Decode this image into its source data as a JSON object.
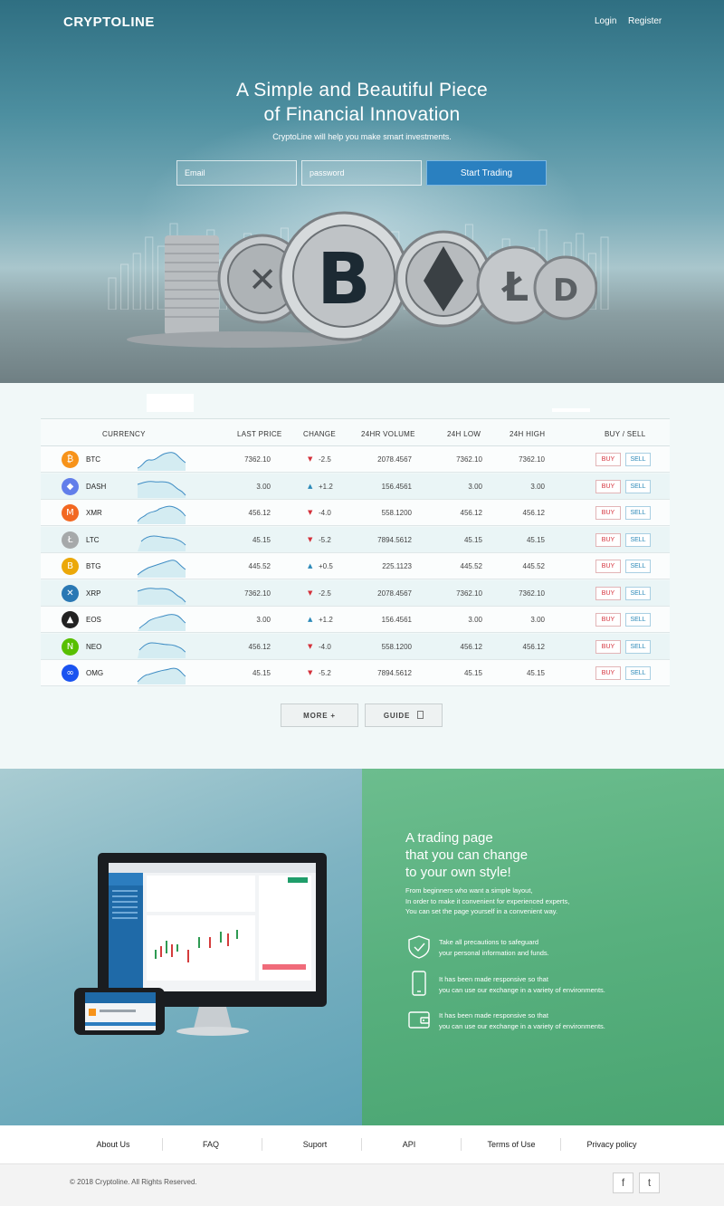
{
  "header": {
    "brand": "CRYPTOLINE",
    "login": "Login",
    "register": "Register"
  },
  "hero": {
    "title_line1": "A Simple and Beautiful Piece",
    "title_line2": "of Financial Innovation",
    "subtitle": "CryptoLine will help you make smart investments.",
    "email_placeholder": "Email",
    "password_placeholder": "password",
    "start_label": "Start Trading"
  },
  "market": {
    "headers": {
      "currency": "CURRENCY",
      "last_price": "LAST PRICE",
      "change": "CHANGE",
      "volume": "24HR VOLUME",
      "low": "24H LOW",
      "high": "24H HIGH",
      "buysell": "BUY / SELL"
    },
    "buy_label": "BUY",
    "sell_label": "SELL",
    "rows": [
      {
        "symbol": "BTC",
        "icon": "bitcoin-icon",
        "color": "#f7931a",
        "glyph": "₿",
        "price": "7362.10",
        "change": "-2.5",
        "dir": "down",
        "volume": "2078.4567",
        "low": "7362.10",
        "high": "7362.10"
      },
      {
        "symbol": "DASH",
        "icon": "ethereum-icon",
        "color": "#627eea",
        "glyph": "◆",
        "price": "3.00",
        "change": "+1.2",
        "dir": "up",
        "volume": "156.4561",
        "low": "3.00",
        "high": "3.00"
      },
      {
        "symbol": "XMR",
        "icon": "monero-icon",
        "color": "#f26822",
        "glyph": "M",
        "price": "456.12",
        "change": "-4.0",
        "dir": "down",
        "volume": "558.1200",
        "low": "456.12",
        "high": "456.12"
      },
      {
        "symbol": "LTC",
        "icon": "litecoin-icon",
        "color": "#a6a9aa",
        "glyph": "Ł",
        "price": "45.15",
        "change": "-5.2",
        "dir": "down",
        "volume": "7894.5612",
        "low": "45.15",
        "high": "45.15"
      },
      {
        "symbol": "BTG",
        "icon": "bitcoin-gold-icon",
        "color": "#eba809",
        "glyph": "B",
        "price": "445.52",
        "change": "+0.5",
        "dir": "up",
        "volume": "225.1123",
        "low": "445.52",
        "high": "445.52"
      },
      {
        "symbol": "XRP",
        "icon": "ripple-icon",
        "color": "#2a78b4",
        "glyph": "✕",
        "price": "7362.10",
        "change": "-2.5",
        "dir": "down",
        "volume": "2078.4567",
        "low": "7362.10",
        "high": "7362.10"
      },
      {
        "symbol": "EOS",
        "icon": "eos-icon",
        "color": "#222222",
        "glyph": "▲",
        "price": "3.00",
        "change": "+1.2",
        "dir": "up",
        "volume": "156.4561",
        "low": "3.00",
        "high": "3.00"
      },
      {
        "symbol": "NEO",
        "icon": "neo-icon",
        "color": "#58bf00",
        "glyph": "N",
        "price": "456.12",
        "change": "-4.0",
        "dir": "down",
        "volume": "558.1200",
        "low": "456.12",
        "high": "456.12"
      },
      {
        "symbol": "OMG",
        "icon": "omisego-icon",
        "color": "#1a53f0",
        "glyph": "∞",
        "price": "45.15",
        "change": "-5.2",
        "dir": "down",
        "volume": "7894.5612",
        "low": "45.15",
        "high": "45.15"
      }
    ],
    "more_label": "MORE +",
    "guide_label": "GUIDE"
  },
  "promo": {
    "title_line1": "A trading page",
    "title_line2": "that you can change",
    "title_line3": "to your own style!",
    "desc_line1": "From beginners who want a simple layout,",
    "desc_line2": "In order to make it convenient for experienced experts,",
    "desc_line3": "You can set the page yourself in a convenient way.",
    "features": [
      {
        "icon": "shield-icon",
        "line1": "Take all precautions to safeguard",
        "line2": "your personal information and funds."
      },
      {
        "icon": "mobile-icon",
        "line1": "It has been made responsive so that",
        "line2": "you can use our exchange in a variety of environments."
      },
      {
        "icon": "wallet-icon",
        "line1": "It has been made responsive so that",
        "line2": "you can use our exchange in a variety of environments."
      }
    ]
  },
  "footer": {
    "links": [
      "About Us",
      "FAQ",
      "Suport",
      "API",
      "Terms of Use",
      "Privacy policy"
    ],
    "copyright": "© 2018 Cryptoline. All Rights Reserved.",
    "facebook": "f",
    "twitter": "t"
  },
  "colors": {
    "buy": "#d4303a",
    "sell": "#2b89b8",
    "up": "#2b89b8",
    "down": "#d4303a",
    "primary": "#2a80c0"
  }
}
